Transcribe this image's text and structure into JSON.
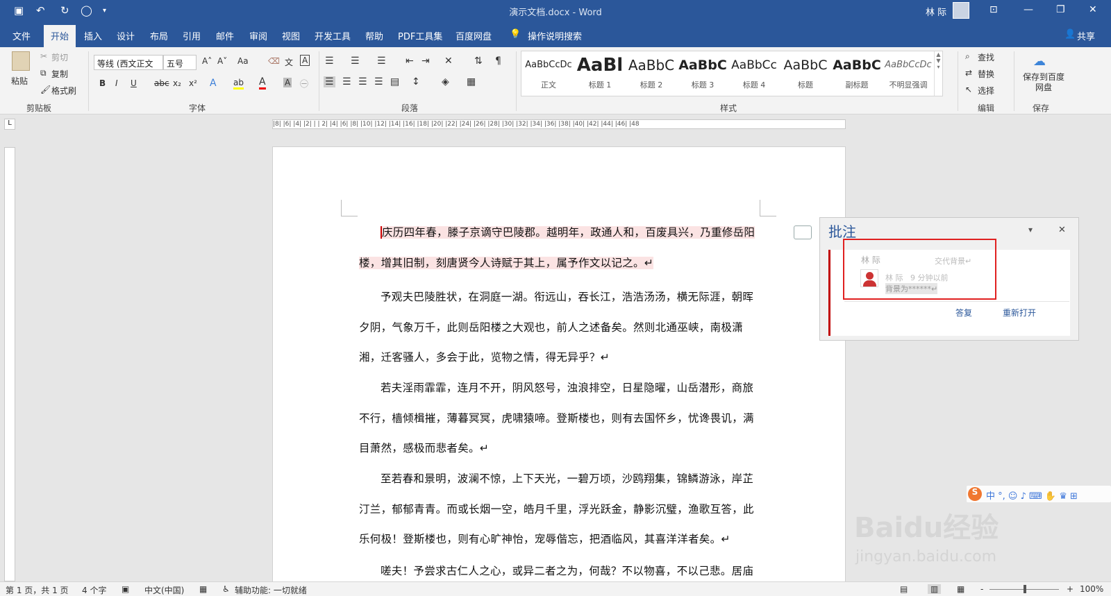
{
  "titlebar": {
    "title": "演示文档.docx - Word",
    "user": "林 际",
    "save_icon": "▣",
    "undo_icon": "↶",
    "redo_icon": "↻",
    "circle_icon": "◯",
    "qa_more": "▾",
    "ribbon_display_icon": "⊡",
    "minimize": "—",
    "restore": "❐",
    "close": "✕"
  },
  "tabs": [
    "文件",
    "开始",
    "插入",
    "设计",
    "布局",
    "引用",
    "邮件",
    "审阅",
    "视图",
    "开发工具",
    "帮助",
    "PDF工具集",
    "百度网盘"
  ],
  "search_hint": "操作说明搜索",
  "share": "共享",
  "ribbon": {
    "clipboard": {
      "paste": "粘贴",
      "cut": "剪切",
      "copy": "复制",
      "format_painter": "格式刷",
      "label": "剪贴板"
    },
    "font": {
      "name": "等线 (西文正文",
      "size": "五号",
      "label": "字体",
      "bold": "B",
      "italic": "I",
      "underline": "U",
      "strike": "abc",
      "sub": "x₂",
      "sup": "x²",
      "grow": "A˄",
      "shrink": "A˅",
      "case": "Aa",
      "effects": "A",
      "highlight": "ab",
      "color": "A",
      "shade": "A"
    },
    "paragraph": {
      "label": "段落"
    },
    "styles": {
      "label": "样式",
      "items": [
        {
          "sample": "AaBbCcDc",
          "name": "正文"
        },
        {
          "sample": "AaBl",
          "name": "标题 1"
        },
        {
          "sample": "AaBbC",
          "name": "标题 2"
        },
        {
          "sample": "AaBbC",
          "name": "标题 3"
        },
        {
          "sample": "AaBbCc",
          "name": "标题 4"
        },
        {
          "sample": "AaBbC",
          "name": "标题"
        },
        {
          "sample": "AaBbC",
          "name": "副标题"
        },
        {
          "sample": "AaBbCcDc",
          "name": "不明显强调"
        }
      ]
    },
    "editing": {
      "find": "查找",
      "replace": "替换",
      "select": "选择",
      "label": "编辑"
    },
    "save": {
      "btn": "保存到百度网盘",
      "label": "保存"
    }
  },
  "ruler_text": "|8|  |6|  |4|  |2|  |  |  2|  |4|  |6|  |8|  |10|  |12|  |14|  |16|  |18|  |20|  |22|  |24|  |26|  |28|  |30|  |32|  |34|  |36|  |38|  |40|  |42|  |44|  |46|  |48",
  "document": {
    "paragraphs": [
      "庆历四年春，滕子京谪守巴陵郡。越明年，政通人和，百废具兴，乃重修岳阳楼，增其旧制，刻唐贤今人诗赋于其上，属予作文以记之。↵",
      "予观夫巴陵胜状，在洞庭一湖。衔远山，吞长江，浩浩汤汤，横无际涯，朝晖夕阴，气象万千，此则岳阳楼之大观也，前人之述备矣。然则北通巫峡，南极潇湘，迁客骚人，多会于此，览物之情，得无异乎？↵",
      "若夫淫雨霏霏，连月不开，阴风怒号，浊浪排空，日星隐曜，山岳潜形，商旅不行，樯倾楫摧，薄暮冥冥，虎啸猿啼。登斯楼也，则有去国怀乡，忧谗畏讥，满目萧然，感极而悲者矣。↵",
      "至若春和景明，波澜不惊，上下天光，一碧万顷，沙鸥翔集，锦鳞游泳，岸芷汀兰，郁郁青青。而或长烟一空，皓月千里，浮光跃金，静影沉璧，渔歌互答，此乐何极！登斯楼也，则有心旷神怡，宠辱偕忘，把酒临风，其喜洋洋者矣。↵",
      "嗟夫！予尝求古仁人之心，或异二者之为，何哉？不以物喜，不以己悲。居庙"
    ]
  },
  "comment_panel": {
    "title": "批注",
    "author": "林 际",
    "header_text": "交代背景↵",
    "reply_author": "林 际",
    "reply_time": "9 分钟以前",
    "reply_text": "背景为******↵",
    "reply_btn": "答复",
    "reopen_btn": "重新打开",
    "dropdown": "▾",
    "close": "✕"
  },
  "statusbar": {
    "page": "第 1 页，共 1 页",
    "words": "4 个字",
    "lang": "中文(中国)",
    "accessibility": "辅助功能: 一切就绪",
    "zoom": "100%",
    "minus": "-",
    "plus": "+"
  },
  "ime": {
    "label": "中 °, ☺ ♪ ⌨ ✋ ♛ ⊞"
  },
  "watermark": {
    "text": "Baidu经验",
    "url": "jingyan.baidu.com"
  },
  "colors": {
    "accent": "#2b579a",
    "comment_red": "#c00000",
    "highlight": "#fbe3e3",
    "squiggle": "#d33"
  }
}
